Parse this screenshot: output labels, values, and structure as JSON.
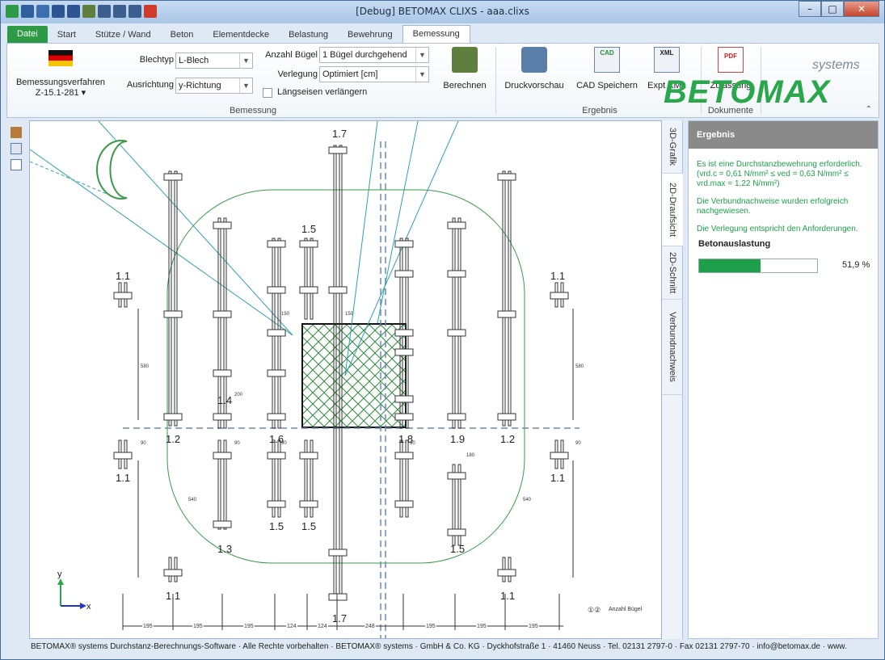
{
  "window": {
    "title": "[Debug] BETOMAX CLIXS - aaa.clixs",
    "min": "–",
    "max": "□",
    "close": "✕"
  },
  "tabs": [
    {
      "label": "Datei"
    },
    {
      "label": "Start"
    },
    {
      "label": "Stütze / Wand"
    },
    {
      "label": "Beton"
    },
    {
      "label": "Elementdecke"
    },
    {
      "label": "Belastung"
    },
    {
      "label": "Bewehrung"
    },
    {
      "label": "Bemessung"
    }
  ],
  "ribbon": {
    "method_label": "Bemessungsverfahren",
    "method_value": "Z-15.1-281 ▾",
    "blechtyp_label": "Blechtyp",
    "blechtyp_value": "L-Blech",
    "ausrichtung_label": "Ausrichtung",
    "ausrichtung_value": "y-Richtung",
    "buegel_label": "Anzahl Bügel",
    "buegel_value": "1 Bügel durchgehend",
    "verlegung_label": "Verlegung",
    "verlegung_value": "Optimiert [cm]",
    "laengseisen_label": "Längseisen verlängern",
    "berechnen": "Berechnen",
    "group_bemessung": "Bemessung",
    "druckvorschau": "Druckvorschau",
    "cad_speichern": "CAD Speichern",
    "expt_xml": "Expt XML",
    "group_ergebnis": "Ergebnis",
    "zulassung": "Zulassung",
    "group_dokumente": "Dokumente",
    "brand": "BETOMAX",
    "brand_sub": "systems",
    "icon_cad": "CAD",
    "icon_xml": "XML",
    "icon_pdf": "PDF"
  },
  "view_tabs": [
    "3D-Grafik",
    "2D-Draufsicht",
    "2D-Schnitt",
    "Verbundnachweis"
  ],
  "panel": {
    "title": "Ergebnis",
    "msg1": "Es ist eine Durchstanzbewehrung erforderlich. (vrd.c = 0,61 N/mm² ≤ ved = 0,63 N/mm² ≤ vrd.max = 1,22 N/mm²)",
    "msg2": "Die Verbundnachweise wurden erfolgreich nachgewiesen.",
    "msg3": "Die Verlegung entspricht den Anforderungen.",
    "auslastung_label": "Betonauslastung",
    "auslastung_value": "51,9 %",
    "auslastung_fraction": 0.519
  },
  "drawing": {
    "labels": [
      "1.7",
      "1.5",
      "1.1",
      "1.1",
      "1.4",
      "1.2",
      "1.6",
      "1.8",
      "1.9",
      "1.2",
      "1.1",
      "1.1",
      "1.5",
      "1.5",
      "1.5",
      "1.3",
      "1.1",
      "1.7",
      "1.1"
    ],
    "dims": [
      "195",
      "195",
      "195",
      "124",
      "124",
      "248",
      "195",
      "195",
      "195"
    ],
    "vdims": [
      "580",
      "580",
      "150",
      "150",
      "200",
      "90",
      "90",
      "90",
      "90",
      "90",
      "180",
      "540",
      "540"
    ],
    "legend": "Anzahl Bügel",
    "legend_marks": "①②",
    "axis_x": "x",
    "axis_y": "y"
  },
  "status": "BETOMAX® systems Durchstanz-Berechnungs-Software · Alle Rechte vorbehalten · BETOMAX® systems · GmbH & Co. KG · Dyckhofstraße 1 · 41460 Neuss · Tel. 02131 2797-0 · Fax 02131 2797-70 · info@betomax.de · www."
}
